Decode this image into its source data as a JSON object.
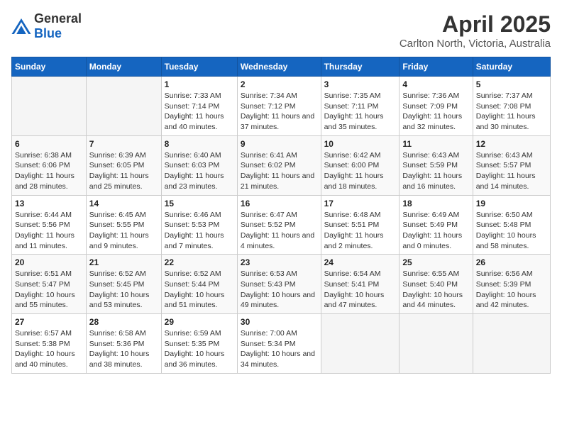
{
  "header": {
    "logo_general": "General",
    "logo_blue": "Blue",
    "title": "April 2025",
    "subtitle": "Carlton North, Victoria, Australia"
  },
  "days_of_week": [
    "Sunday",
    "Monday",
    "Tuesday",
    "Wednesday",
    "Thursday",
    "Friday",
    "Saturday"
  ],
  "weeks": [
    [
      {
        "day": "",
        "sunrise": "",
        "sunset": "",
        "daylight": ""
      },
      {
        "day": "",
        "sunrise": "",
        "sunset": "",
        "daylight": ""
      },
      {
        "day": "1",
        "sunrise": "Sunrise: 7:33 AM",
        "sunset": "Sunset: 7:14 PM",
        "daylight": "Daylight: 11 hours and 40 minutes."
      },
      {
        "day": "2",
        "sunrise": "Sunrise: 7:34 AM",
        "sunset": "Sunset: 7:12 PM",
        "daylight": "Daylight: 11 hours and 37 minutes."
      },
      {
        "day": "3",
        "sunrise": "Sunrise: 7:35 AM",
        "sunset": "Sunset: 7:11 PM",
        "daylight": "Daylight: 11 hours and 35 minutes."
      },
      {
        "day": "4",
        "sunrise": "Sunrise: 7:36 AM",
        "sunset": "Sunset: 7:09 PM",
        "daylight": "Daylight: 11 hours and 32 minutes."
      },
      {
        "day": "5",
        "sunrise": "Sunrise: 7:37 AM",
        "sunset": "Sunset: 7:08 PM",
        "daylight": "Daylight: 11 hours and 30 minutes."
      }
    ],
    [
      {
        "day": "6",
        "sunrise": "Sunrise: 6:38 AM",
        "sunset": "Sunset: 6:06 PM",
        "daylight": "Daylight: 11 hours and 28 minutes."
      },
      {
        "day": "7",
        "sunrise": "Sunrise: 6:39 AM",
        "sunset": "Sunset: 6:05 PM",
        "daylight": "Daylight: 11 hours and 25 minutes."
      },
      {
        "day": "8",
        "sunrise": "Sunrise: 6:40 AM",
        "sunset": "Sunset: 6:03 PM",
        "daylight": "Daylight: 11 hours and 23 minutes."
      },
      {
        "day": "9",
        "sunrise": "Sunrise: 6:41 AM",
        "sunset": "Sunset: 6:02 PM",
        "daylight": "Daylight: 11 hours and 21 minutes."
      },
      {
        "day": "10",
        "sunrise": "Sunrise: 6:42 AM",
        "sunset": "Sunset: 6:00 PM",
        "daylight": "Daylight: 11 hours and 18 minutes."
      },
      {
        "day": "11",
        "sunrise": "Sunrise: 6:43 AM",
        "sunset": "Sunset: 5:59 PM",
        "daylight": "Daylight: 11 hours and 16 minutes."
      },
      {
        "day": "12",
        "sunrise": "Sunrise: 6:43 AM",
        "sunset": "Sunset: 5:57 PM",
        "daylight": "Daylight: 11 hours and 14 minutes."
      }
    ],
    [
      {
        "day": "13",
        "sunrise": "Sunrise: 6:44 AM",
        "sunset": "Sunset: 5:56 PM",
        "daylight": "Daylight: 11 hours and 11 minutes."
      },
      {
        "day": "14",
        "sunrise": "Sunrise: 6:45 AM",
        "sunset": "Sunset: 5:55 PM",
        "daylight": "Daylight: 11 hours and 9 minutes."
      },
      {
        "day": "15",
        "sunrise": "Sunrise: 6:46 AM",
        "sunset": "Sunset: 5:53 PM",
        "daylight": "Daylight: 11 hours and 7 minutes."
      },
      {
        "day": "16",
        "sunrise": "Sunrise: 6:47 AM",
        "sunset": "Sunset: 5:52 PM",
        "daylight": "Daylight: 11 hours and 4 minutes."
      },
      {
        "day": "17",
        "sunrise": "Sunrise: 6:48 AM",
        "sunset": "Sunset: 5:51 PM",
        "daylight": "Daylight: 11 hours and 2 minutes."
      },
      {
        "day": "18",
        "sunrise": "Sunrise: 6:49 AM",
        "sunset": "Sunset: 5:49 PM",
        "daylight": "Daylight: 11 hours and 0 minutes."
      },
      {
        "day": "19",
        "sunrise": "Sunrise: 6:50 AM",
        "sunset": "Sunset: 5:48 PM",
        "daylight": "Daylight: 10 hours and 58 minutes."
      }
    ],
    [
      {
        "day": "20",
        "sunrise": "Sunrise: 6:51 AM",
        "sunset": "Sunset: 5:47 PM",
        "daylight": "Daylight: 10 hours and 55 minutes."
      },
      {
        "day": "21",
        "sunrise": "Sunrise: 6:52 AM",
        "sunset": "Sunset: 5:45 PM",
        "daylight": "Daylight: 10 hours and 53 minutes."
      },
      {
        "day": "22",
        "sunrise": "Sunrise: 6:52 AM",
        "sunset": "Sunset: 5:44 PM",
        "daylight": "Daylight: 10 hours and 51 minutes."
      },
      {
        "day": "23",
        "sunrise": "Sunrise: 6:53 AM",
        "sunset": "Sunset: 5:43 PM",
        "daylight": "Daylight: 10 hours and 49 minutes."
      },
      {
        "day": "24",
        "sunrise": "Sunrise: 6:54 AM",
        "sunset": "Sunset: 5:41 PM",
        "daylight": "Daylight: 10 hours and 47 minutes."
      },
      {
        "day": "25",
        "sunrise": "Sunrise: 6:55 AM",
        "sunset": "Sunset: 5:40 PM",
        "daylight": "Daylight: 10 hours and 44 minutes."
      },
      {
        "day": "26",
        "sunrise": "Sunrise: 6:56 AM",
        "sunset": "Sunset: 5:39 PM",
        "daylight": "Daylight: 10 hours and 42 minutes."
      }
    ],
    [
      {
        "day": "27",
        "sunrise": "Sunrise: 6:57 AM",
        "sunset": "Sunset: 5:38 PM",
        "daylight": "Daylight: 10 hours and 40 minutes."
      },
      {
        "day": "28",
        "sunrise": "Sunrise: 6:58 AM",
        "sunset": "Sunset: 5:36 PM",
        "daylight": "Daylight: 10 hours and 38 minutes."
      },
      {
        "day": "29",
        "sunrise": "Sunrise: 6:59 AM",
        "sunset": "Sunset: 5:35 PM",
        "daylight": "Daylight: 10 hours and 36 minutes."
      },
      {
        "day": "30",
        "sunrise": "Sunrise: 7:00 AM",
        "sunset": "Sunset: 5:34 PM",
        "daylight": "Daylight: 10 hours and 34 minutes."
      },
      {
        "day": "",
        "sunrise": "",
        "sunset": "",
        "daylight": ""
      },
      {
        "day": "",
        "sunrise": "",
        "sunset": "",
        "daylight": ""
      },
      {
        "day": "",
        "sunrise": "",
        "sunset": "",
        "daylight": ""
      }
    ]
  ]
}
